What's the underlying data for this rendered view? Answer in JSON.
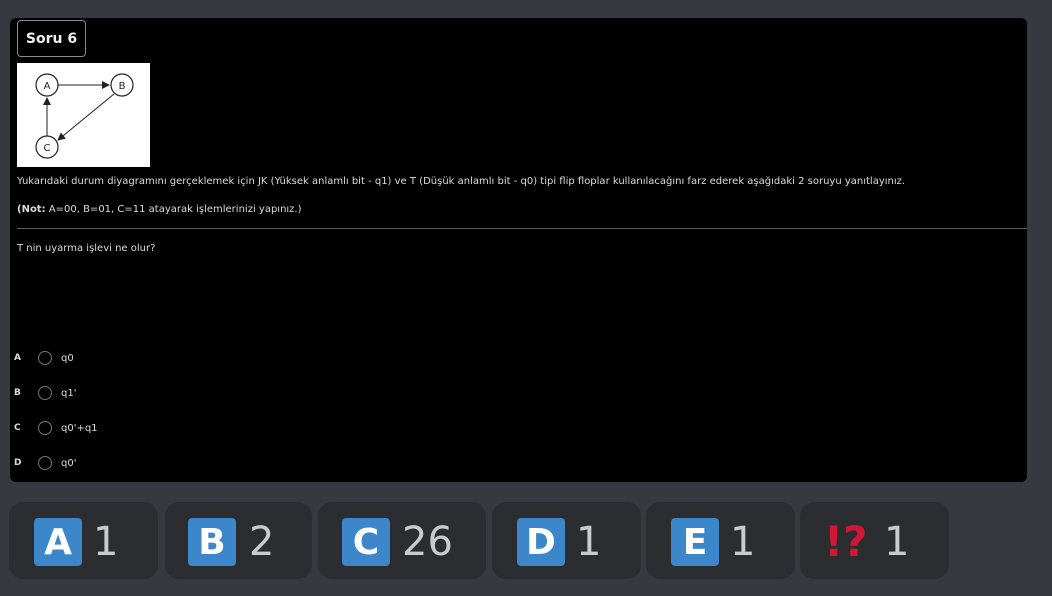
{
  "question": {
    "badge": "Soru 6",
    "statement": "Yukarıdaki durum diyagramını gerçeklemek için JK (Yüksek anlamlı bit - q1) ve T (Düşük anlamlı bit - q0) tipi flip floplar kullanılacağını farz ederek aşağıdaki 2 soruyu yanıtlayınız.",
    "note_bold": "(Not:",
    "note_rest": " A=00, B=01, C=11 atayarak işlemlerinizi yapınız.)",
    "prompt": "T nin uyarma işlevi ne olur?",
    "diagram": {
      "nodes": [
        "A",
        "B",
        "C"
      ]
    },
    "options": [
      {
        "letter": "A",
        "text": "q0"
      },
      {
        "letter": "B",
        "text": "q1'"
      },
      {
        "letter": "C",
        "text": "q0'+q1"
      },
      {
        "letter": "D",
        "text": "q0'"
      }
    ]
  },
  "tallies": [
    {
      "label": "A",
      "count": "1",
      "color": "#3c87c9"
    },
    {
      "label": "B",
      "count": "2",
      "color": "#3c87c9"
    },
    {
      "label": "C",
      "count": "26",
      "color": "#3c87c9"
    },
    {
      "label": "D",
      "count": "1",
      "color": "#3c87c9"
    },
    {
      "label": "E",
      "count": "1",
      "color": "#3c87c9"
    },
    {
      "label": "!?",
      "count": "1",
      "color": "#d01835"
    }
  ]
}
